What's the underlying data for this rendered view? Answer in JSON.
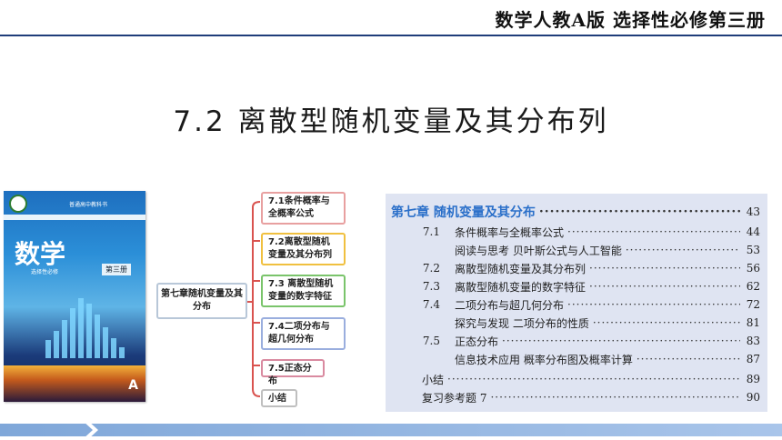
{
  "header": {
    "title": "数学人教A版  选择性必修第三册"
  },
  "section_title": "7.2 离散型随机变量及其分布列",
  "book_cover": {
    "publisher": "普通高中教科书",
    "title": "数学",
    "subtitle": "选择性必修",
    "volume": "第三册",
    "edition_mark": "A"
  },
  "mindmap": {
    "root": "第七章随机变量及其分布",
    "branches": [
      "7.1条件概率与全概率公式",
      "7.2离散型随机变量及其分布列",
      "7.3 离散型随机变量的数字特征",
      "7.4二项分布与超几何分布",
      "7.5正态分布",
      "小结"
    ]
  },
  "toc": {
    "chapter": {
      "label": "第七章  随机变量及其分布",
      "page": "43"
    },
    "entries": [
      {
        "num": "7.1",
        "label": "条件概率与全概率公式",
        "page": "44"
      },
      {
        "num": "",
        "label": "阅读与思考  贝叶斯公式与人工智能",
        "page": "53"
      },
      {
        "num": "7.2",
        "label": "离散型随机变量及其分布列",
        "page": "56"
      },
      {
        "num": "7.3",
        "label": "离散型随机变量的数字特征",
        "page": "62"
      },
      {
        "num": "7.4",
        "label": "二项分布与超几何分布",
        "page": "72"
      },
      {
        "num": "",
        "label": "探究与发现  二项分布的性质",
        "page": "81"
      },
      {
        "num": "7.5",
        "label": "正态分布",
        "page": "83"
      },
      {
        "num": "",
        "label": "信息技术应用  概率分布图及概率计算",
        "page": "87"
      },
      {
        "num": "",
        "label": "小结",
        "page": "89"
      },
      {
        "num": "",
        "label": "复习参考题 7",
        "page": "90"
      }
    ]
  },
  "colors": {
    "accent": "#1f3d7a",
    "toc_chapter": "#2a6fc9",
    "toc_bg": "#dfe4f2"
  }
}
